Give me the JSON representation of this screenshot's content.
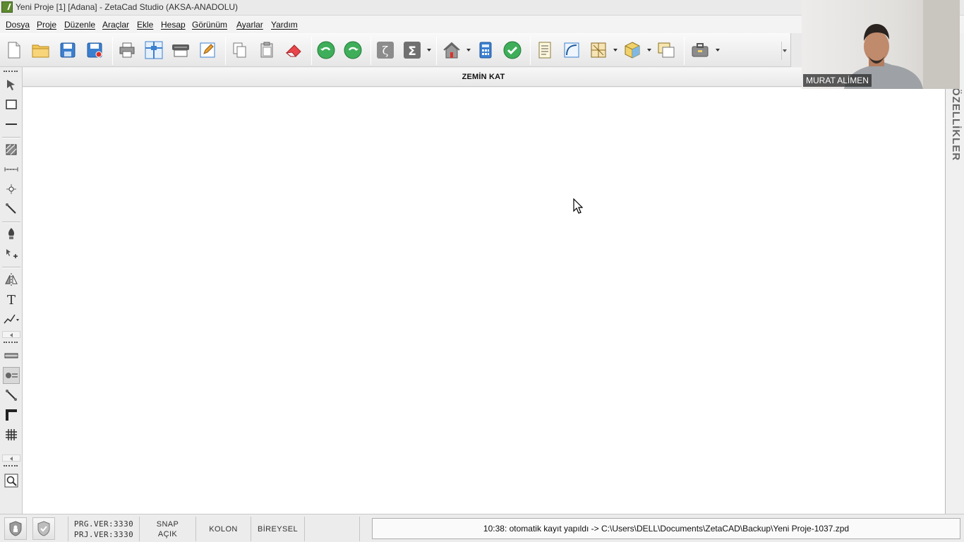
{
  "window": {
    "title": "Yeni Proje  [1]  [Adana]  - ZetaCad Studio (AKSA-ANADOLU)"
  },
  "menu": {
    "items": [
      {
        "label": "Dosya"
      },
      {
        "label": "Proje"
      },
      {
        "label": "Düzenle"
      },
      {
        "label": "Araçlar"
      },
      {
        "label": "Ekle"
      },
      {
        "label": "Hesap"
      },
      {
        "label": "Görünüm"
      },
      {
        "label": "Ayarlar"
      },
      {
        "label": "Yardım"
      }
    ]
  },
  "toolbar": {
    "icons": [
      "new-file-icon",
      "open-folder-icon",
      "save-icon",
      "save-as-icon",
      "print-icon",
      "axis-icon",
      "plotter-icon",
      "edit-document-icon",
      "copy-icon",
      "paste-icon",
      "eraser-icon",
      "undo-icon",
      "redo-icon",
      "zeta-icon",
      "sigma-icon",
      "house-icon",
      "calculator-icon",
      "check-icon",
      "report-icon",
      "drawing-icon",
      "layout-icon",
      "cube-icon",
      "layers-icon",
      "toolbox-icon"
    ]
  },
  "floor": {
    "title": "ZEMİN KAT"
  },
  "left_toolbar": {
    "icons": [
      "select-arrow-icon",
      "rectangle-icon",
      "line-icon",
      "hatch-icon",
      "dimension-icon",
      "point-icon",
      "slope-icon",
      "pen-icon",
      "move-icon",
      "mirror-icon",
      "text-icon",
      "polyline-icon",
      "beam-icon",
      "foundation-icon",
      "connection-icon",
      "corner-icon",
      "grid-icon",
      "zoom-window-icon"
    ]
  },
  "webcam": {
    "name": "MURAT ALİMEN"
  },
  "right_panel": {
    "tab_label": "ÖZELLİKLER"
  },
  "status": {
    "prg_version": "PRG.VER:3330",
    "prj_version": "PRJ.VER:3330",
    "snap_label": "SNAP",
    "snap_state": "AÇIK",
    "kolon": "KOLON",
    "mode": "BİREYSEL",
    "message": "10:38: otomatik kayıt yapıldı -> C:\\Users\\DELL\\Documents\\ZetaCAD\\Backup\\Yeni Proje-1037.zpd"
  }
}
